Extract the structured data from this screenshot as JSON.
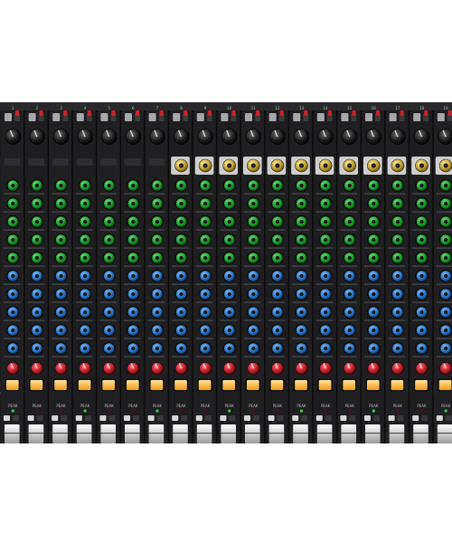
{
  "image": {
    "subject": "mixing-console-photo",
    "page_background": "#ffffff",
    "console": {
      "channel_count": 19,
      "upper_channels_with_gold_trim": 12,
      "knob_rows": [
        {
          "color": "#1fa52e"
        },
        {
          "color": "#1fa52e"
        },
        {
          "color": "#1fa52e"
        },
        {
          "color": "#1fa52e"
        },
        {
          "color": "#1fa52e"
        },
        {
          "color": "#2d7fd6"
        },
        {
          "color": "#2d7fd6"
        },
        {
          "color": "#2d7fd6"
        },
        {
          "color": "#2d7fd6"
        },
        {
          "color": "#2d7fd6"
        },
        {
          "color": "#e8e8e8"
        },
        {
          "color": "#e8e8e8"
        },
        {
          "color": "#c4202a"
        }
      ],
      "colors": {
        "panel": "#1c1c1e",
        "strip_divider": "#0b0b0c",
        "led_button": "#f6b02a",
        "red_switch": "#d0202a",
        "gold_knob": "#c9a53a",
        "fader": "#d9d9d9"
      },
      "labels": {
        "channel_numbers": [
          "1",
          "2",
          "3",
          "4",
          "5",
          "6",
          "7",
          "8",
          "9",
          "10",
          "11",
          "12",
          "13",
          "14",
          "15",
          "16",
          "17",
          "18",
          "19"
        ],
        "peak": "PEAK"
      }
    }
  }
}
